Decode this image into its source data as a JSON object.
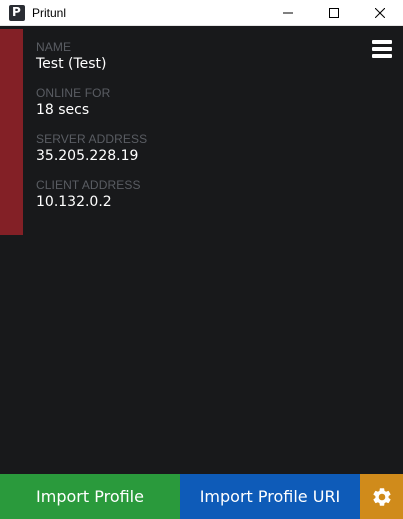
{
  "window": {
    "title": "Pritunl",
    "app_icon_letter": "P",
    "controls": [
      "minimize-icon",
      "maximize-icon",
      "close-icon"
    ]
  },
  "colors": {
    "background": "#18191b",
    "profile_accent": "#832026",
    "import_profile": "#2a9a3c",
    "import_profile_uri": "#0e5bb8",
    "settings": "#d08b1b"
  },
  "profile": {
    "name_label": "NAME",
    "name_value": "Test (Test)",
    "online_label": "ONLINE FOR",
    "online_value": "18 secs",
    "server_label": "SERVER ADDRESS",
    "server_value": "35.205.228.19",
    "client_label": "CLIENT ADDRESS",
    "client_value": "10.132.0.2",
    "menu_icon": "hamburger-menu-icon"
  },
  "footer": {
    "import_profile_label": "Import Profile",
    "import_profile_uri_label": "Import Profile URI",
    "settings_icon": "gear-icon"
  }
}
